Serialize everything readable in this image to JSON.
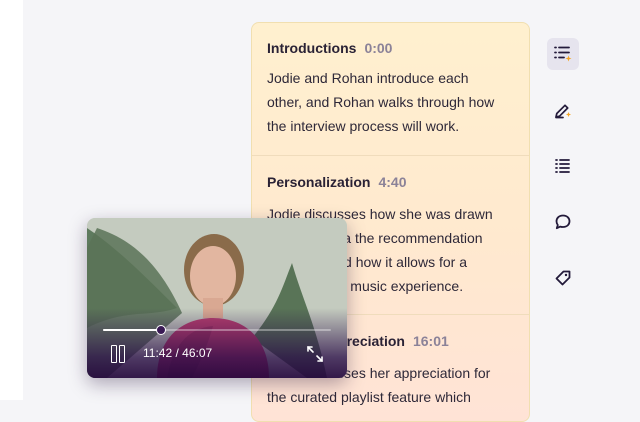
{
  "transcript": {
    "sections": [
      {
        "title": "Introductions",
        "time": "0:00",
        "lines": [
          "Jodie and Rohan introduce each",
          "other, and Rohan walks through how",
          "the interview process will work."
        ]
      },
      {
        "title": "Personalization",
        "time": "4:40",
        "lines": [
          "Jodie discusses how she was drawn",
          "to the app via the recommendation",
          "algorithm and how it allows for a",
          "personalized music experience."
        ]
      },
      {
        "title": "Playlist Appreciation",
        "time": "16:01",
        "lines": [
          "Jodie discusses her appreciation for",
          "the curated playlist feature which"
        ]
      }
    ]
  },
  "sidebar": {
    "items": [
      {
        "icon": "ai-chapters-icon",
        "active": true
      },
      {
        "icon": "ai-edit-icon",
        "active": false
      },
      {
        "icon": "transcript-list-icon",
        "active": false
      },
      {
        "icon": "comment-icon",
        "active": false
      },
      {
        "icon": "tag-icon",
        "active": false
      }
    ]
  },
  "player": {
    "time_display": "11:42 / 46:07",
    "progress_fraction": 0.254,
    "state": "playing"
  },
  "colors": {
    "accent_spark": "#f5a524",
    "icon": "#231a3a",
    "player_overlay": "#3a1a55"
  }
}
